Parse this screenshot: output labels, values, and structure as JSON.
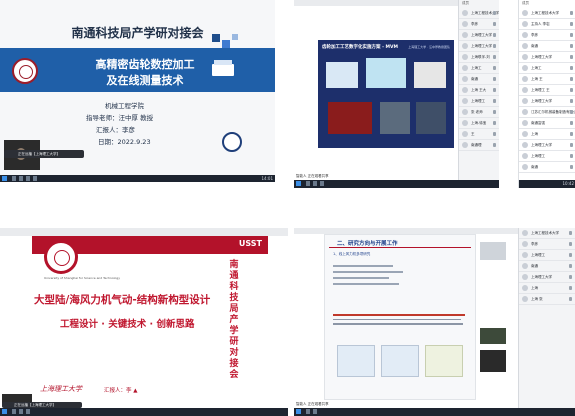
{
  "q1": {
    "title": "南通科技局产学研对接会",
    "topic_line1": "高精密齿轮数控加工",
    "topic_line2": "及在线测量技术",
    "dept": "机械工程学院",
    "advisor": "指导老师：汪中厚 教授",
    "reporter": "汇报人：李彦",
    "date": "日期：2022.9.23",
    "taskbar_tab": "正在远播【上海理工大学】",
    "clock": "14:01"
  },
  "q2": {
    "slide_title": "齿轮加工工艺数字化实施方案 - MVM",
    "slide_subtitle": "上海理工大学 · 汪中厚教授团队",
    "taskbar_tab": "智能人 正在观看共享",
    "sidebar_header": "成员",
    "participants": [
      "上海工程技术大学",
      "李彦",
      "上海理工大学",
      "上海理工大学",
      "上海联孚-刘",
      "上海工",
      "南通",
      "上海 王大",
      "上海理工",
      "张 老师",
      "上海-徐宝",
      "王",
      "南通理"
    ]
  },
  "q3": {
    "sidebar_header": "成员",
    "participants": [
      "上海工程技术大学",
      "主持人 李岩",
      "李彦",
      "南通",
      "上海理工大学",
      "上海工",
      "上海 王",
      "上海理工 王",
      "上海理工大学",
      "江苏汇尔机械装备制造有限公司",
      "南通富强",
      "上海",
      "上海理工大学",
      "上海理工",
      "南通"
    ],
    "clock": "10:42"
  },
  "q4": {
    "brand": "USST",
    "title": "大型陆/海风力机气动-结构新构型设计",
    "subtitle": "工程设计 · 关键技术 · 创新思路",
    "vertical_title": [
      "南",
      "通",
      "科",
      "技",
      "局",
      "产",
      "学",
      "研",
      "对",
      "接",
      "会"
    ],
    "school_en": "University of Shanghai for Science and Technology",
    "school_cn": "上海理工大学",
    "reporter": "汇报人：李 ▲",
    "taskbar_tab": "正在远播【上海理工大学】"
  },
  "q5": {
    "slide_title": "二、研究方向与开展工作",
    "point_heading": "1、线上风力机多项研究",
    "taskbar_tab": "智能人 正在观看共享",
    "participants": [
      "上海工程技术大学",
      "李彦",
      "上海理工",
      "南通",
      "上海理工大学",
      "上海",
      "上海 张"
    ]
  }
}
